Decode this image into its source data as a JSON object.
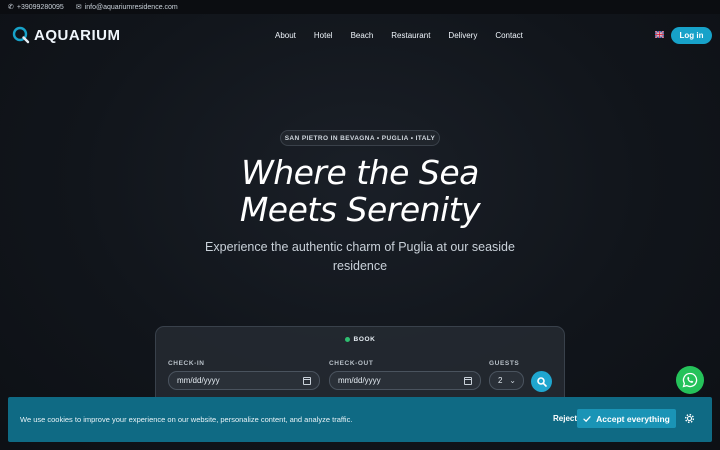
{
  "topbar": {
    "phone": "+39099280095",
    "email": "info@aquariumresidence.com"
  },
  "brand": {
    "name": "AQUARIUM",
    "accent": "#17a2c9"
  },
  "nav": {
    "items": [
      {
        "label": "About"
      },
      {
        "label": "Hotel"
      },
      {
        "label": "Beach"
      },
      {
        "label": "Restaurant"
      },
      {
        "label": "Delivery"
      },
      {
        "label": "Contact"
      }
    ],
    "login_label": "Log in",
    "language_flag": "uk-flag-icon"
  },
  "hero": {
    "badge": "SAN PIETRO IN BEVAGNA • PUGLIA • ITALY",
    "title_line1": "Where the Sea",
    "title_line2": "Meets Serenity",
    "subtitle": "Experience the authentic charm of Puglia at our seaside residence"
  },
  "booking": {
    "heading": "BOOK",
    "checkin_label": "CHECK-IN",
    "checkin_placeholder": "mm/dd/yyyy",
    "checkout_label": "CHECK-OUT",
    "checkout_placeholder": "mm/dd/yyyy",
    "guests_label": "GUESTS",
    "guests_value": "2",
    "status_color": "#2fbf71"
  },
  "cookie_banner": {
    "text": "We use cookies to improve your experience on our website, personalize content, and analyze traffic.",
    "reject_label": "Reject",
    "accept_label": "Accept everything"
  },
  "colors": {
    "whatsapp": "#25c25a",
    "cookie_bg": "#0f6a84"
  }
}
